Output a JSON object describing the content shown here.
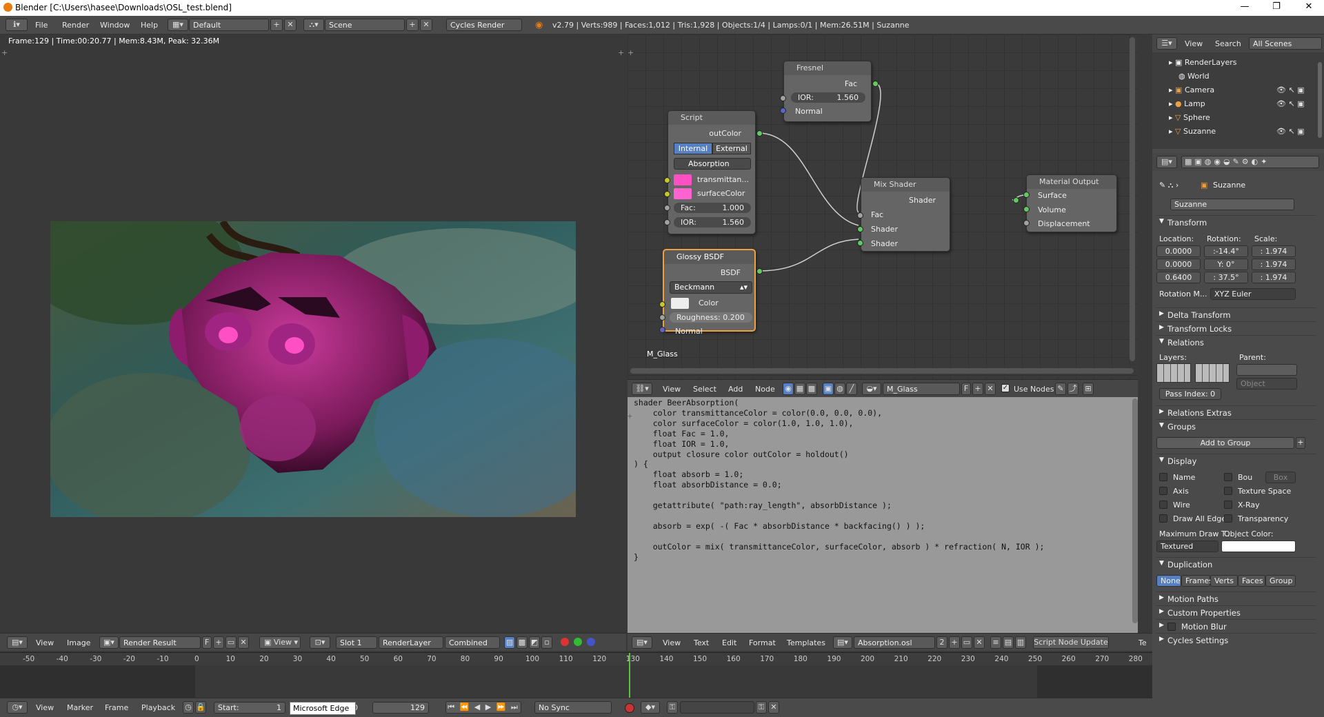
{
  "window": {
    "title": "Blender [C:\\Users\\hasee\\Downloads\\OSL_test.blend]",
    "min": "—",
    "max": "❐",
    "close": "✕"
  },
  "info_header": {
    "menus": [
      "File",
      "Render",
      "Window",
      "Help"
    ],
    "layout": "Default",
    "scene": "Scene",
    "engine": "Cycles Render",
    "stats": "v2.79 | Verts:989 | Faces:1,012 | Tris:1,928 | Objects:1/4 | Lamps:0/1 | Mem:26.51M | Suzanne"
  },
  "image_editor": {
    "render_info": "Frame:129 | Time:00:20.77 | Mem:8.43M, Peak: 32.36M",
    "header": {
      "view": "View",
      "image": "Image",
      "image_name": "Render Result",
      "f": "F",
      "view_menu": "View",
      "slot": "Slot 1",
      "layer": "RenderLayer",
      "pass": "Combined"
    }
  },
  "node_editor": {
    "material_label": "M_Glass",
    "fresnel": {
      "title": "Fresnel",
      "fac": "Fac",
      "ior_label": "IOR:",
      "ior_value": "1.560",
      "normal": "Normal"
    },
    "script": {
      "title": "Script",
      "out": "outColor",
      "internal": "Internal",
      "external": "External",
      "script_name": "Absorption",
      "in1": "transmittan...",
      "in2": "surfaceColor",
      "fac_label": "Fac:",
      "fac_value": "1.000",
      "ior_label": "IOR:",
      "ior_value": "1.560"
    },
    "glossy": {
      "title": "Glossy BSDF",
      "out": "BSDF",
      "distribution": "Beckmann",
      "color": "Color",
      "roughness_label": "Roughness:",
      "roughness_value": "0.200",
      "normal": "Normal"
    },
    "mix": {
      "title": "Mix Shader",
      "out": "Shader",
      "fac": "Fac",
      "in1": "Shader",
      "in2": "Shader"
    },
    "output": {
      "title": "Material Output",
      "surface": "Surface",
      "volume": "Volume",
      "displacement": "Displacement"
    },
    "header": {
      "view": "View",
      "select": "Select",
      "add": "Add",
      "node": "Node",
      "material": "M_Glass",
      "f": "F",
      "use_nodes": "Use Nodes"
    }
  },
  "text_editor": {
    "code": "shader BeerAbsorption(\n    color transmittanceColor = color(0.0, 0.0, 0.0),\n    color surfaceColor = color(1.0, 1.0, 1.0),\n    float Fac = 1.0,\n    float IOR = 1.0,\n    output closure color outColor = holdout()\n) {\n    float absorb = 1.0;\n    float absorbDistance = 0.0;\n\n    getattribute( \"path:ray_length\", absorbDistance );\n\n    absorb = exp( -( Fac * absorbDistance * backfacing() ) );\n\n    outColor = mix( transmittanceColor, surfaceColor, absorb ) * refraction( N, IOR );\n}",
    "header": {
      "view": "View",
      "text": "Text",
      "edit": "Edit",
      "format": "Format",
      "templates": "Templates",
      "file": "Absorption.osl",
      "users": "2",
      "update": "Script Node Update",
      "te": "Te"
    }
  },
  "outliner": {
    "view": "View",
    "search": "Search",
    "filter": "All Scenes",
    "items": [
      {
        "name": "RenderLayers"
      },
      {
        "name": "World"
      },
      {
        "name": "Camera"
      },
      {
        "name": "Lamp"
      },
      {
        "name": "Sphere"
      },
      {
        "name": "Suzanne"
      }
    ]
  },
  "properties": {
    "object": "Suzanne",
    "object_field": "Suzanne",
    "transform": "Transform",
    "location_label": "Location:",
    "rotation_label": "Rotation:",
    "scale_label": "Scale:",
    "location": [
      "0.0000",
      "0.0000",
      "0.6400"
    ],
    "rotation": [
      ":-14.4°",
      "Y:    0°",
      ": 37.5°"
    ],
    "scale": [
      ": 1.974",
      ": 1.974",
      ": 1.974"
    ],
    "rotation_mode_label": "Rotation M...",
    "rotation_mode": "XYZ Euler",
    "delta": "Delta Transform",
    "locks": "Transform Locks",
    "relations": "Relations",
    "layers": "Layers:",
    "parent": "Parent:",
    "parent_type": "Object",
    "pass_index": "Pass Index:",
    "pass_value": "0",
    "relations_extras": "Relations Extras",
    "groups": "Groups",
    "add_to_group": "Add to Group",
    "display": "Display",
    "display_opts": {
      "name": "Name",
      "bou": "Bou",
      "box": "Box",
      "axis": "Axis",
      "texture_space": "Texture Space",
      "wire": "Wire",
      "xray": "X-Ray",
      "draw_all_edges": "Draw All Edges",
      "transparency": "Transparency"
    },
    "max_draw": "Maximum Draw T...",
    "object_color": "Object Color:",
    "draw_type": "Textured",
    "duplication": "Duplication",
    "dup_opts": [
      "None",
      "Frames",
      "Verts",
      "Faces",
      "Group"
    ],
    "motion_paths": "Motion Paths",
    "custom_props": "Custom Properties",
    "motion_blur": "Motion Blur",
    "cycles_settings": "Cycles Settings"
  },
  "timeline": {
    "ticks": [
      "-50",
      "-40",
      "-30",
      "-20",
      "-10",
      "0",
      "10",
      "20",
      "30",
      "40",
      "50",
      "60",
      "70",
      "80",
      "90",
      "100",
      "110",
      "120",
      "130",
      "140",
      "150",
      "160",
      "170",
      "180",
      "190",
      "200",
      "210",
      "220",
      "230",
      "240",
      "250",
      "260",
      "270",
      "280"
    ],
    "current_frame": 129,
    "view": "View",
    "marker": "Marker",
    "frame": "Frame",
    "playback": "Playback",
    "start_label": "Start:",
    "start_value": "1",
    "tooltip": "Microsoft Edge",
    "end_partial": "0",
    "current": "129",
    "sync": "No Sync"
  },
  "colors": {
    "accent": "#5680c2",
    "node_selected": "#f0a040",
    "socket_shader": "#63c763",
    "socket_color": "#c7c729",
    "pink": "#ff4fc4"
  }
}
